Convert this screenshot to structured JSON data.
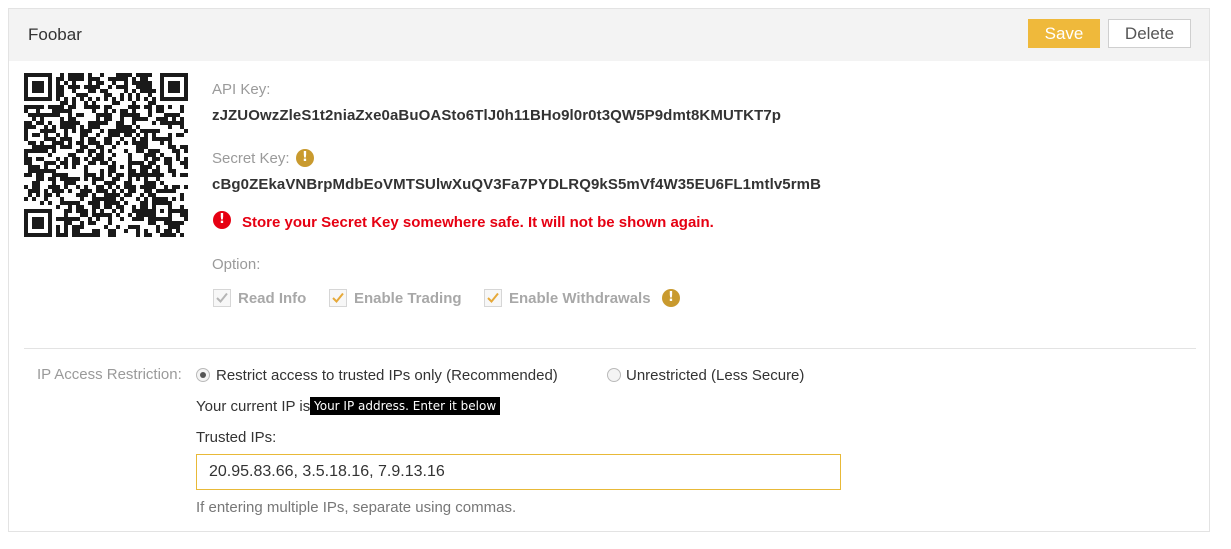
{
  "header": {
    "title": "Foobar",
    "save_label": "Save",
    "delete_label": "Delete"
  },
  "keys": {
    "api_key_label": "API Key:",
    "api_key_value": "zJZUOwzZleS1t2niaZxe0aBuOASto6TlJ0h11BHo9l0r0t3QW5P9dmt8KMUTKT7p",
    "secret_key_label": "Secret Key:",
    "secret_key_value": "cBg0ZEkaVNBrpMdbEoVMTSUlwXuQV3Fa7PYDLRQ9kS5mVf4W35EU6FL1mtlv5rmB",
    "warning_icon_glyph": "!",
    "error_icon_glyph": "!",
    "secret_warning": "Store your Secret Key somewhere safe. It will not be shown again."
  },
  "options": {
    "label": "Option:",
    "items": [
      {
        "label": "Read Info",
        "checked": true,
        "disabled": true
      },
      {
        "label": "Enable Trading",
        "checked": true,
        "disabled": false
      },
      {
        "label": "Enable Withdrawals",
        "checked": true,
        "disabled": false
      }
    ],
    "withdrawals_icon_glyph": "!"
  },
  "ip_restriction": {
    "label": "IP Access Restriction:",
    "option_restricted": "Restrict access to trusted IPs only (Recommended)",
    "option_unrestricted": "Unrestricted (Less Secure)",
    "selected": "restricted",
    "current_ip_text": "Your current IP is",
    "tooltip_text": "Your IP address. Enter it below",
    "trusted_ips_label": "Trusted IPs:",
    "trusted_ips_value": "20.95.83.66, 3.5.18.16, 7.9.13.16",
    "hint": "If entering multiple IPs, separate using commas."
  },
  "colors": {
    "accent": "#efb93b",
    "error": "#e60012",
    "warning_icon": "#c99a2e"
  },
  "icons": {
    "qr": "qr-code-icon",
    "warning": "warning-icon",
    "error": "error-icon",
    "checkmark": "checkmark-icon"
  }
}
